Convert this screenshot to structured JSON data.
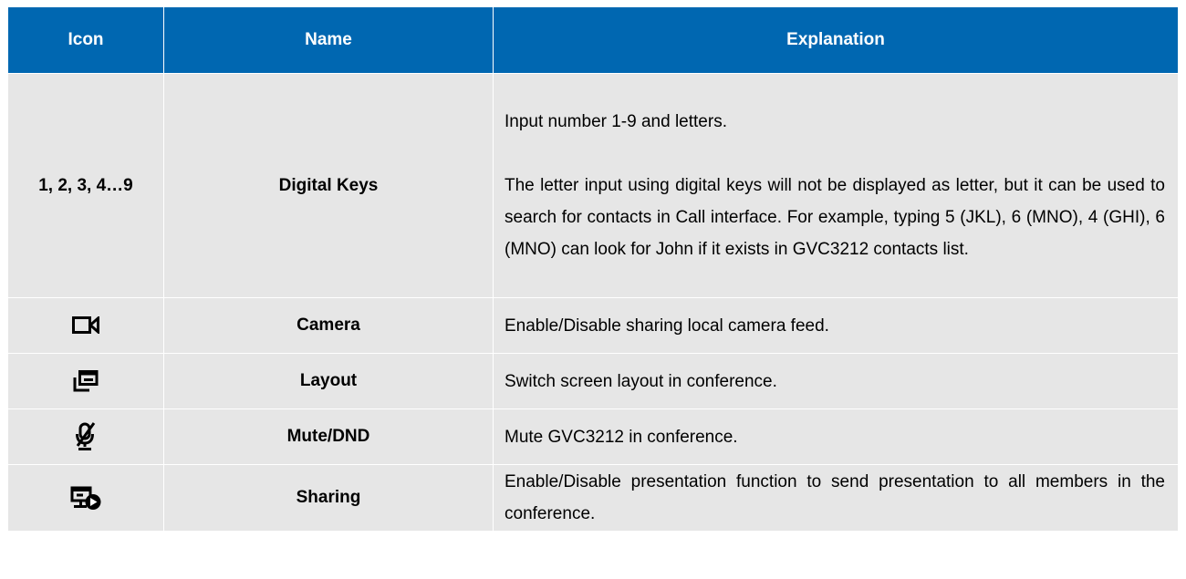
{
  "table": {
    "headers": {
      "icon": "Icon",
      "name": "Name",
      "explanation": "Explanation"
    },
    "rows": [
      {
        "icon_text": "1, 2, 3, 4…9",
        "name": "Digital Keys",
        "explanation": [
          "Input number 1-9 and letters.",
          "The letter input using digital keys will not be displayed as letter, but it can be used to search for contacts in Call interface. For example, typing 5 (JKL), 6 (MNO), 4 (GHI), 6 (MNO) can look for John if it exists in GVC3212 contacts list."
        ]
      },
      {
        "icon": "camera-icon",
        "name": "Camera",
        "explanation": [
          "Enable/Disable sharing local camera feed."
        ]
      },
      {
        "icon": "layout-icon",
        "name": "Layout",
        "explanation": [
          "Switch screen layout in conference."
        ]
      },
      {
        "icon": "mute-icon",
        "name": "Mute/DND",
        "explanation": [
          "Mute GVC3212 in conference."
        ]
      },
      {
        "icon": "sharing-icon",
        "name": "Sharing",
        "explanation": [
          "Enable/Disable presentation function to send presentation to all members in the conference."
        ]
      }
    ]
  },
  "colors": {
    "header_bg": "#0067b1",
    "header_text": "#ffffff",
    "row_bg": "#e6e6e6"
  }
}
